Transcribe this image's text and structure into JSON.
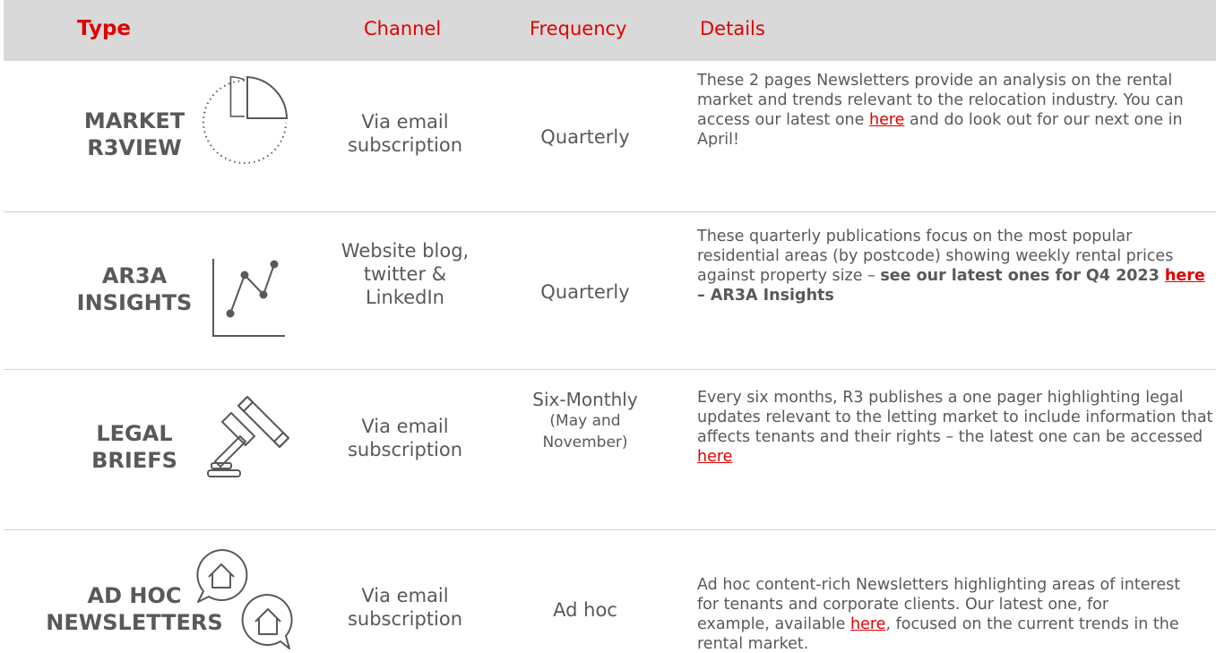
{
  "header": {
    "type": "Type",
    "channel": "Channel",
    "frequency": "Frequency",
    "details": "Details"
  },
  "colors": {
    "accent": "#e00000",
    "header_bg": "#d9d9d9",
    "text": "#595959"
  },
  "rows": [
    {
      "type_line1": "MARKET",
      "type_line2": "R3VIEW",
      "icon": "pie-chart-icon",
      "channel_line1": "Via email",
      "channel_line2": "subscription",
      "frequency": "Quarterly",
      "details_a": "These 2 pages Newsletters provide an analysis on the rental market and trends relevant to the relocation industry. You can access our latest one ",
      "details_link": "here",
      "details_b": " and do look out for our next one in April!"
    },
    {
      "type_line1": "AR3A",
      "type_line2": "INSIGHTS",
      "icon": "line-chart-icon",
      "channel_line1": "Website blog,",
      "channel_line2": "twitter &",
      "channel_line3": "LinkedIn",
      "frequency": "Quarterly",
      "details_a": "These quarterly publications focus on the most popular residential areas (by postcode) showing weekly rental prices against property size – ",
      "details_bold": "see our latest ones for Q4 2023 ",
      "details_link": "here",
      "details_bold_b": " – AR3A Insights"
    },
    {
      "type_line1": "LEGAL",
      "type_line2": "BRIEFS",
      "icon": "gavel-icon",
      "channel_line1": "Via email",
      "channel_line2": "subscription",
      "frequency_line1": "Six-Monthly",
      "frequency_line2": "(May and",
      "frequency_line3": "November)",
      "details_a": "Every six months, R3 publishes a one pager highlighting legal updates relevant to the letting market to include information that affects tenants and their rights – the latest one can be accessed ",
      "details_link": "here"
    },
    {
      "type_line1": "AD HOC",
      "type_line2": "NEWSLETTERS",
      "icon": "chat-house-icon",
      "channel_line1": "Via email",
      "channel_line2": "subscription",
      "frequency": "Ad hoc",
      "details_a": "Ad hoc content-rich Newsletters highlighting areas of interest for tenants and corporate clients. Our latest one, for example, available ",
      "details_link": "here",
      "details_b": ", focused on the current trends in the rental market."
    }
  ]
}
